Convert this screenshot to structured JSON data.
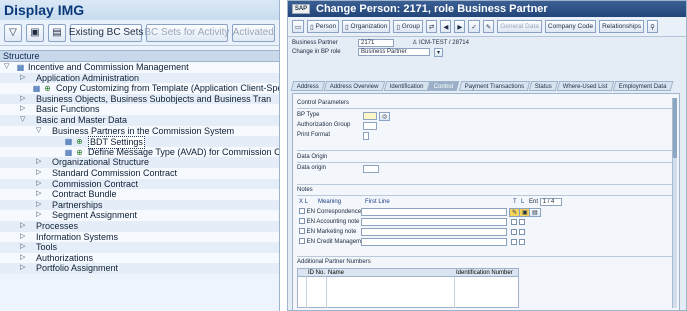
{
  "left": {
    "title": "Display IMG",
    "toolbar": {
      "existing_bc_sets": "Existing BC Sets",
      "bc_sets_for_activity": "BC Sets for Activity",
      "activated": "Activated"
    },
    "structure_label": "Structure",
    "tree": [
      {
        "label": "Incentive and Commission Management",
        "level": 0,
        "expanded": true,
        "icons": 1
      },
      {
        "label": "Application Administration",
        "level": 1,
        "expanded": false,
        "icons": 0
      },
      {
        "label": "Copy Customizing from Template (Application Client-Specific",
        "level": 1,
        "expanded": null,
        "icons": 2
      },
      {
        "label": "Business Objects, Business Subobjects and Business Tran",
        "level": 1,
        "expanded": false,
        "icons": 0
      },
      {
        "label": "Basic Functions",
        "level": 1,
        "expanded": false,
        "icons": 0
      },
      {
        "label": "Basic and Master Data",
        "level": 1,
        "expanded": true,
        "icons": 0
      },
      {
        "label": "Business Partners in the Commission System",
        "level": 2,
        "expanded": true,
        "icons": 0
      },
      {
        "label": "BDT Settings",
        "level": 3,
        "expanded": null,
        "icons": 2,
        "selected": true
      },
      {
        "label": "Define Message Type (AVAD) for Commission Contra",
        "level": 3,
        "expanded": null,
        "icons": 2
      },
      {
        "label": "Organizational Structure",
        "level": 2,
        "expanded": false,
        "icons": 0
      },
      {
        "label": "Standard Commission Contract",
        "level": 2,
        "expanded": false,
        "icons": 0
      },
      {
        "label": "Commission Contract",
        "level": 2,
        "expanded": false,
        "icons": 0
      },
      {
        "label": "Contract Bundle",
        "level": 2,
        "expanded": false,
        "icons": 0
      },
      {
        "label": "Partnerships",
        "level": 2,
        "expanded": false,
        "icons": 0
      },
      {
        "label": "Segment Assignment",
        "level": 2,
        "expanded": false,
        "icons": 0
      },
      {
        "label": "Processes",
        "level": 1,
        "expanded": false,
        "icons": 0
      },
      {
        "label": "Information Systems",
        "level": 1,
        "expanded": false,
        "icons": 0
      },
      {
        "label": "Tools",
        "level": 1,
        "expanded": false,
        "icons": 0
      },
      {
        "label": "Authorizations",
        "level": 1,
        "expanded": false,
        "icons": 0
      },
      {
        "label": "Portfolio Assignment",
        "level": 1,
        "expanded": false,
        "icons": 0
      }
    ]
  },
  "right": {
    "title": "Change Person: 2171, role Business Partner",
    "toolbar": {
      "person": "Person",
      "organization": "Organization",
      "group": "Group",
      "general_data": "General Data",
      "company_code": "Company Code",
      "relationships": "Relationships"
    },
    "header_fields": {
      "bp_label": "Business Partner",
      "bp_value": "2171",
      "bp_text": "ICM-TEST / 28714",
      "role_label": "Change in BP role",
      "role_value": "Business Partner"
    },
    "tabs": [
      "Address",
      "Address Overview",
      "Identification",
      "Control",
      "Payment Transactions",
      "Status",
      "Where-Used List",
      "Employment Data"
    ],
    "active_tab": "Control",
    "control_params": {
      "section": "Control Parameters",
      "bp_type": "BP Type",
      "auth_group": "Authorization Group",
      "print_format": "Print Format"
    },
    "data_origin": {
      "section": "Data Origin",
      "label": "Data origin"
    },
    "notes": {
      "section": "Notes",
      "col_x": "X",
      "col_l": "L",
      "col_meaning": "Meaning",
      "col_first_line": "First Line",
      "col_t": "T",
      "col_l2": "L",
      "entry_label": "Ent",
      "entry_value": "1 / 4",
      "rows": [
        {
          "lang": "EN",
          "meaning": "Correspondence"
        },
        {
          "lang": "EN",
          "meaning": "Accounting note"
        },
        {
          "lang": "EN",
          "meaning": "Marketing note"
        },
        {
          "lang": "EN",
          "meaning": "Credit Management"
        }
      ]
    },
    "partner_numbers": {
      "section": "Additional Partner Numbers",
      "col_id": "ID No.",
      "col_name": "Name",
      "col_ident": "Identification Number"
    }
  }
}
